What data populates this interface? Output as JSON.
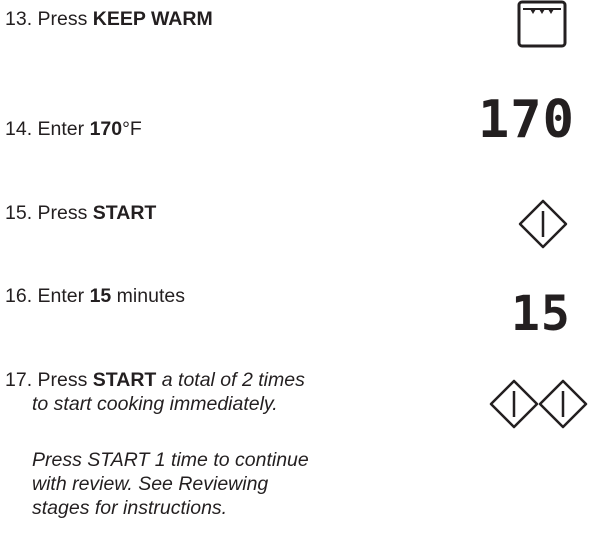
{
  "steps": {
    "s13": {
      "prefix": "13. Press ",
      "bold": "KEEP WARM"
    },
    "s14": {
      "prefix": "14. Enter ",
      "bold": "170",
      "suffix": "°F"
    },
    "s15": {
      "prefix": "15. Press ",
      "bold": "START"
    },
    "s16": {
      "prefix": "16. Enter ",
      "bold": "15",
      "suffix": " minutes"
    },
    "s17": {
      "prefix": "17. Press ",
      "bold": "START",
      "italic_1": " a total of 2 times",
      "italic_2": "to start cooking immediately.",
      "note_1": "Press START 1 time to continue",
      "note_2": "with review. See Reviewing",
      "note_3": "stages for instructions."
    }
  },
  "display": {
    "temperature": "170",
    "minutes": "15"
  },
  "icons": {
    "keep_warm": "keep-warm-oven-icon",
    "start": "start-diamond-icon"
  },
  "colors": {
    "text": "#231f20"
  }
}
